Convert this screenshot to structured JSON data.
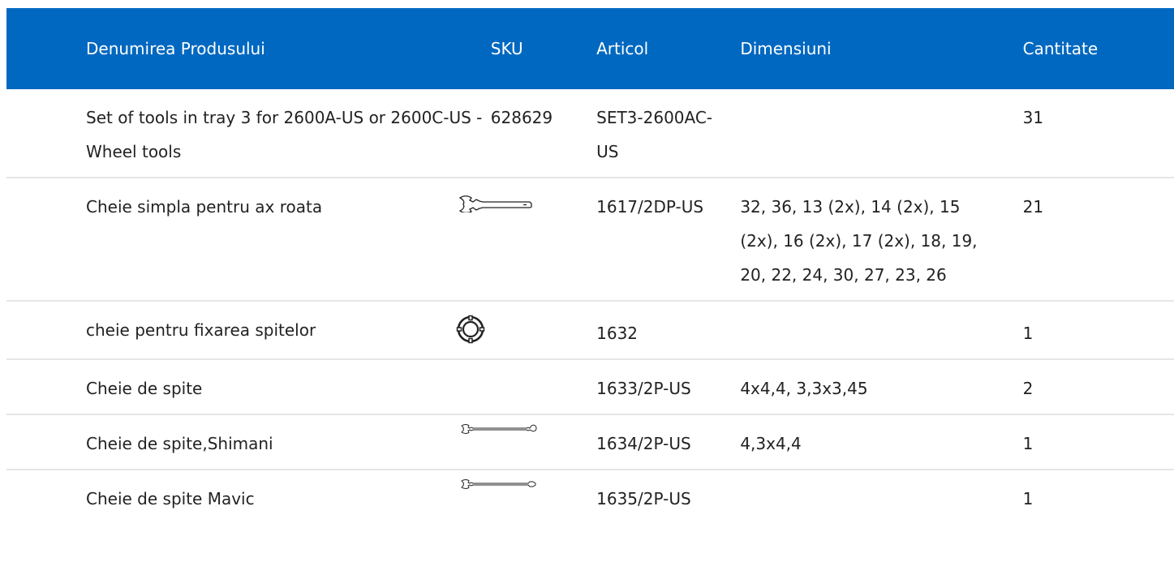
{
  "table": {
    "headers": {
      "name": "Denumirea Produsului",
      "sku": "SKU",
      "article": "Articol",
      "dimensions": "Dimensiuni",
      "quantity": "Cantitate"
    },
    "rows": [
      {
        "name": "Set of tools in tray 3 for 2600A-US or 2600C-US - Wheel tools",
        "sku": "628629",
        "article": "SET3-2600AC-US",
        "dimensions": "",
        "quantity": "31"
      },
      {
        "name": "Cheie simpla pentru ax roata",
        "sku_icon": "open-end-wrench-icon",
        "article": "1617/2DP-US",
        "dimensions": "32, 36, 13 (2x), 14 (2x), 15 (2x), 16 (2x), 17 (2x), 18, 19, 20, 22, 24, 30, 27, 23, 26",
        "quantity": "21"
      },
      {
        "name": "cheie pentru fixarea spitelor",
        "sku_icon": "ring-spoke-key-icon",
        "article": "1632",
        "dimensions": "",
        "quantity": "1"
      },
      {
        "name": "Cheie de spite",
        "article": "1633/2P-US",
        "dimensions": "4x4,4, 3,3x3,45",
        "quantity": "2"
      },
      {
        "name": "Cheie de spite,Shimani",
        "sku_icon": "double-end-spoke-wrench-icon",
        "article": "1634/2P-US",
        "dimensions": "4,3x4,4",
        "quantity": "1"
      },
      {
        "name": "Cheie de spite Mavic",
        "sku_icon": "mavic-spoke-wrench-icon",
        "article": "1635/2P-US",
        "dimensions": "",
        "quantity": "1"
      }
    ]
  },
  "colors": {
    "header_bg": "#0068c0",
    "header_text": "#ffffff",
    "row_divider": "#e6e6e6",
    "body_text": "#222222"
  }
}
